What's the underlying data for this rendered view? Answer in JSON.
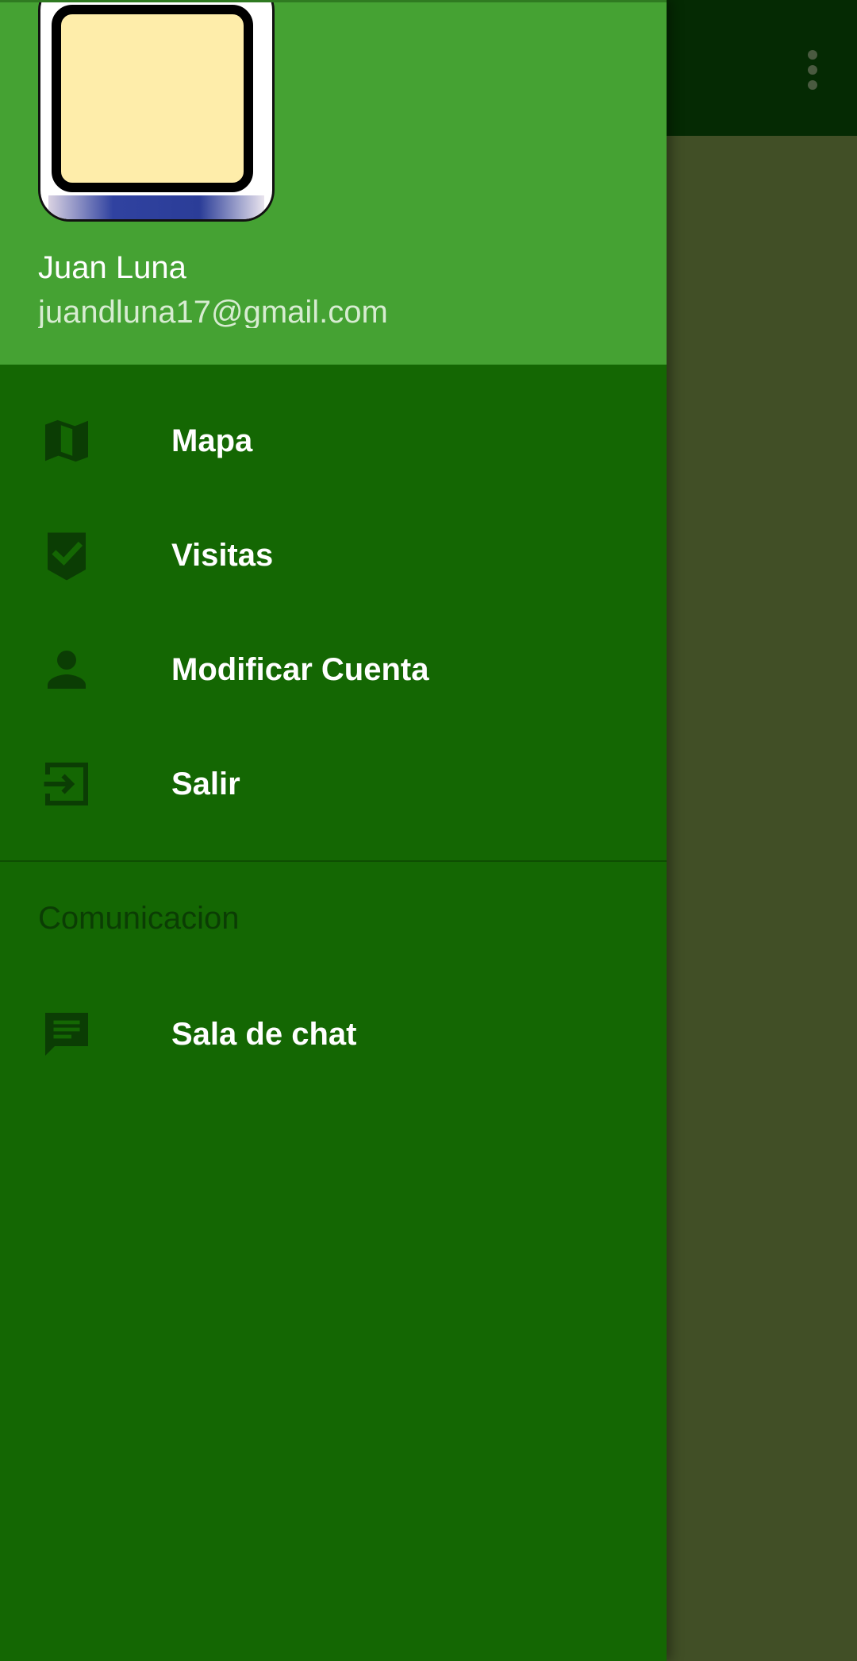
{
  "app_bar": {
    "overflow_icon": "more-vert-icon"
  },
  "drawer": {
    "header": {
      "user_name": "Juan Luna",
      "user_email": "juandluna17@gmail.com",
      "avatar_color": "#feedaa"
    },
    "items": [
      {
        "label": "Mapa",
        "icon": "map-icon"
      },
      {
        "label": "Visitas",
        "icon": "verified-badge-icon"
      },
      {
        "label": "Modificar Cuenta",
        "icon": "person-icon"
      },
      {
        "label": "Salir",
        "icon": "exit-icon"
      }
    ],
    "section": {
      "title": "Comunicacion",
      "items": [
        {
          "label": "Sala de chat",
          "icon": "chat-icon"
        }
      ]
    }
  },
  "colors": {
    "drawer_background": "#146703",
    "header_background": "#45a233",
    "icon_color": "#0b3d04",
    "scrim_background": "#414f26",
    "app_bar_background": "#052a03"
  }
}
